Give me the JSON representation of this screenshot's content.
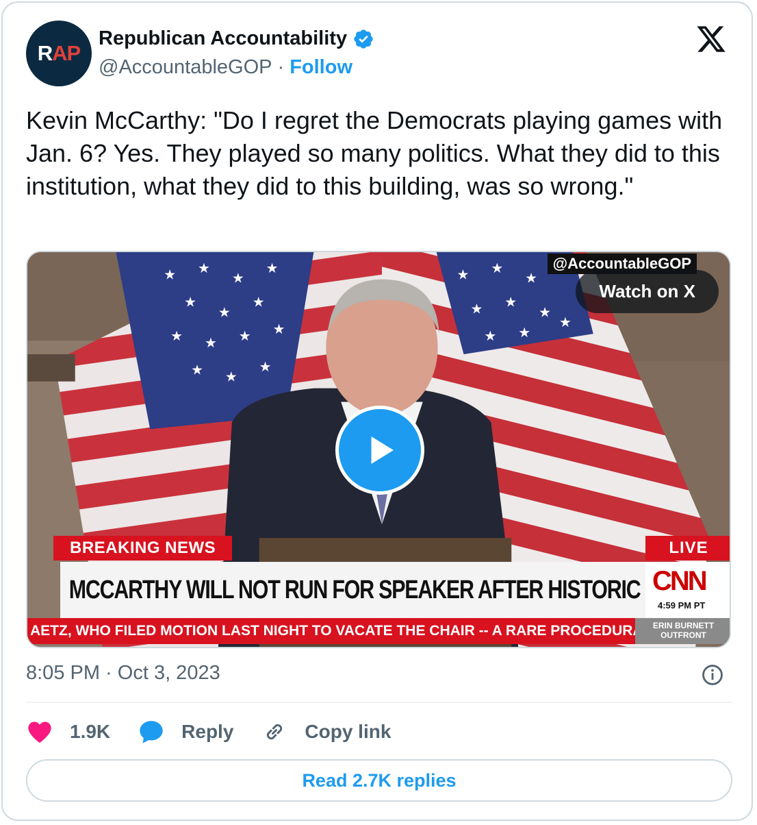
{
  "author": {
    "avatar_initials_first": "R",
    "avatar_initials_rest": "AP",
    "name": "Republican Accountability",
    "handle": "@AccountableGOP",
    "separator": "·",
    "follow_label": "Follow",
    "verified_icon": "verified-badge-icon"
  },
  "tweet": {
    "text": "Kevin McCarthy: \"Do I regret the Democrats playing games with Jan. 6? Yes. They played so many politics. What they did to this institution, what they did to this building, was so wrong.\"",
    "timestamp": "8:05 PM · Oct 3, 2023"
  },
  "media": {
    "watermark": "@AccountableGOP",
    "watch_label": "Watch on X",
    "breaking_label": "BREAKING NEWS",
    "live_label": "LIVE",
    "headline": "MCCARTHY WILL NOT RUN FOR SPEAKER AFTER HISTORIC OUSTER",
    "network_logo": "CNN",
    "network_time": "4:59 PM PT",
    "ticker": "AETZ, WHO FILED MOTION LAST NIGHT TO VACATE THE CHAIR -- A RARE PROCEDURAL M",
    "show_line1": "ERIN BURNETT",
    "show_line2": "OUTFRONT"
  },
  "actions": {
    "like_count": "1.9K",
    "reply_label": "Reply",
    "copy_label": "Copy link"
  },
  "read_replies_label": "Read 2.7K replies",
  "colors": {
    "accent": "#1d9bf0",
    "like": "#f91880",
    "text_secondary": "#536471",
    "border": "#cfd9de",
    "cnn_red": "#d8121f"
  }
}
